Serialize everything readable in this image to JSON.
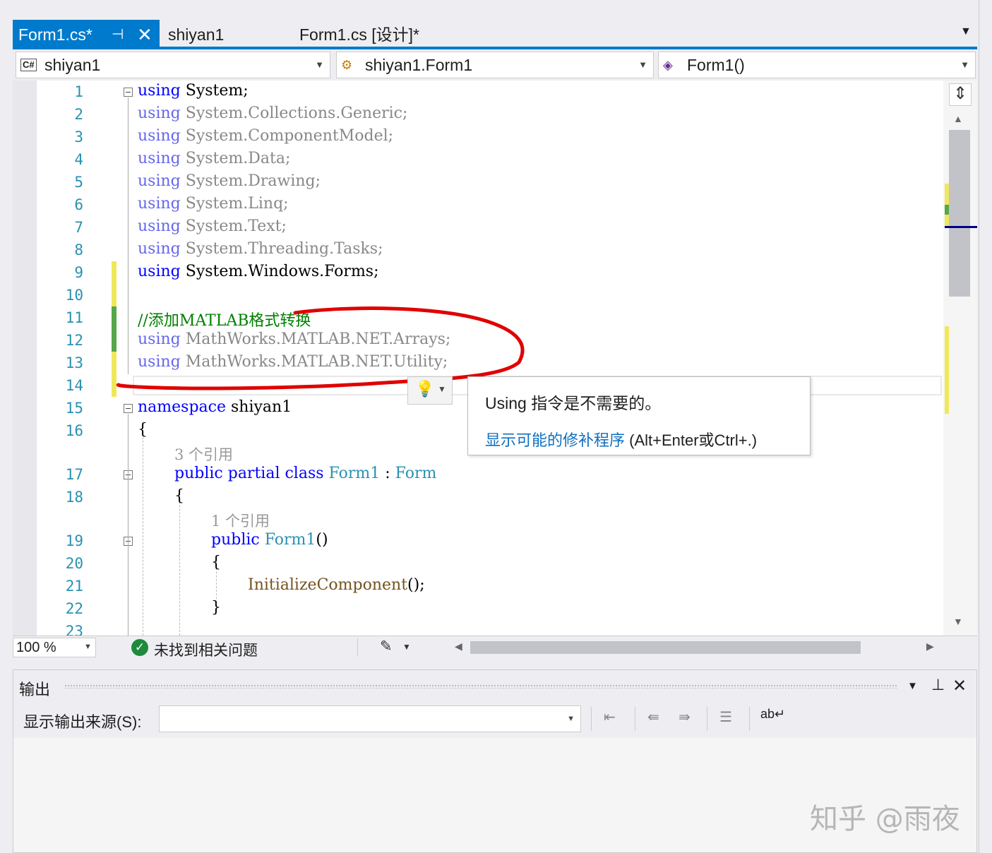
{
  "tabs": {
    "active": {
      "label": "Form1.cs*",
      "pin": "⊕",
      "close": "✕"
    },
    "second": {
      "label": "shiyan1"
    },
    "third": {
      "label": "Form1.cs [设计]*"
    },
    "overflow_icon": "chevron-down-icon"
  },
  "navbar": {
    "project": {
      "icon": "C#",
      "label": "shiyan1"
    },
    "type": {
      "label": "shiyan1.Form1"
    },
    "member": {
      "label": "Form1()"
    }
  },
  "editor": {
    "line_numbers": [
      "1",
      "2",
      "3",
      "4",
      "5",
      "6",
      "7",
      "8",
      "9",
      "10",
      "11",
      "12",
      "13",
      "14",
      "15",
      "16",
      "17",
      "18",
      "19",
      "20",
      "21",
      "22",
      "23"
    ],
    "lines": {
      "l1": {
        "kw": "using",
        "rest": " System;"
      },
      "l2": {
        "kw": "using",
        "rest": " System.Collections.Generic;"
      },
      "l3": {
        "kw": "using",
        "rest": " System.ComponentModel;"
      },
      "l4": {
        "kw": "using",
        "rest": " System.Data;"
      },
      "l5": {
        "kw": "using",
        "rest": " System.Drawing;"
      },
      "l6": {
        "kw": "using",
        "rest": " System.Linq;"
      },
      "l7": {
        "kw": "using",
        "rest": " System.Text;"
      },
      "l8": {
        "kw": "using",
        "rest": " System.Threading.Tasks;"
      },
      "l9": {
        "kw": "using",
        "rest": " System.Windows.Forms;"
      },
      "l11": {
        "comment": "//添加MATLAB格式转换"
      },
      "l12": {
        "kw": "using",
        "rest": " MathWorks.MATLAB.NET.Arrays;"
      },
      "l13": {
        "kw": "using",
        "rest": " MathWorks.MATLAB.NET.Utility;"
      },
      "l15": {
        "kw": "namespace",
        "rest": " shiyan1"
      },
      "l16": {
        "text": "{"
      },
      "lens1": {
        "text": "3 个引用"
      },
      "l17": {
        "kw1": "public",
        "kw2": "partial",
        "kw3": "class",
        "cls": "Form1",
        "colon": " : ",
        "base": "Form"
      },
      "l18": {
        "text": "{"
      },
      "lens2": {
        "text": "1 个引用"
      },
      "l19": {
        "kw": "public",
        "cls": "Form1",
        "paren": "()"
      },
      "l20": {
        "text": "{"
      },
      "l21": {
        "mth": "InitializeComponent",
        "rest": "();"
      },
      "l22": {
        "text": "}"
      }
    }
  },
  "tooltip": {
    "message": "Using 指令是不需要的。",
    "link": "显示可能的修补程序",
    "shortcut": " (Alt+Enter或Ctrl+.)"
  },
  "status": {
    "zoom": "100 %",
    "issues": "未找到相关问题"
  },
  "output": {
    "title": "输出",
    "source_label": "显示输出来源(S):",
    "source_value": ""
  },
  "watermark": "知乎 @雨夜",
  "colors": {
    "accent": "#007acc",
    "annotation": "#e00000",
    "change_saved": "#57a64a",
    "change_unsaved": "#efe85a"
  }
}
